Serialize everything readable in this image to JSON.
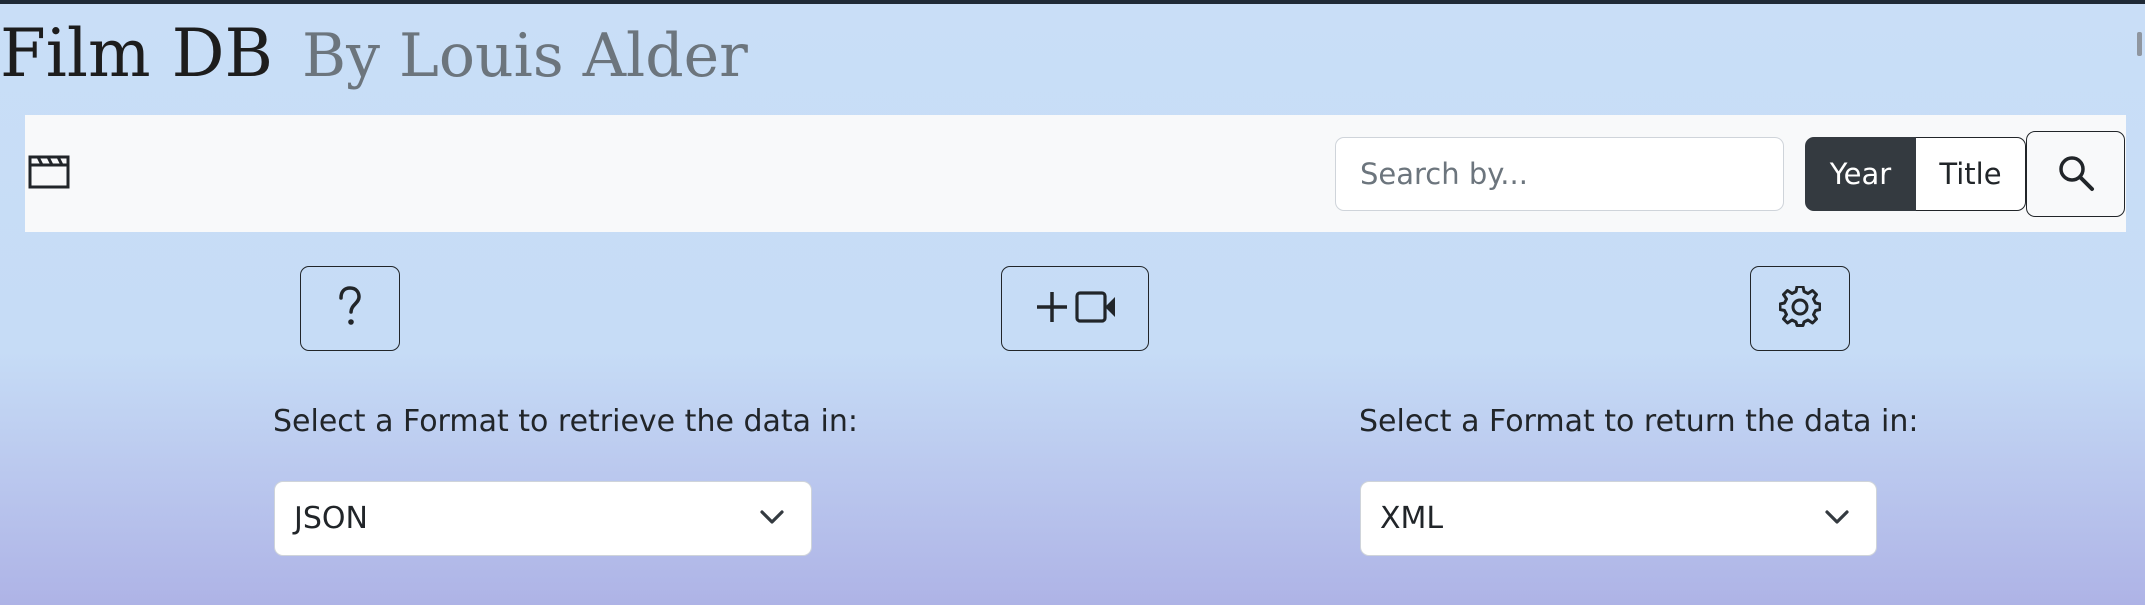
{
  "header": {
    "title": "Film DB",
    "subtitle": "By Louis Alder"
  },
  "navbar": {
    "brand_icon": "film-clapper-icon",
    "search": {
      "placeholder": "Search by...",
      "value": ""
    },
    "toggle": {
      "options": [
        "Year",
        "Title"
      ],
      "selected": "Year"
    },
    "search_button_icon": "search-icon"
  },
  "actions": [
    {
      "name": "help",
      "icon": "question-mark-icon"
    },
    {
      "name": "add-film",
      "icon": "plus-video-icon"
    },
    {
      "name": "settings",
      "icon": "gear-icon"
    }
  ],
  "formats": {
    "retrieve": {
      "label": "Select a Format to retrieve the data in:",
      "selected": "JSON"
    },
    "return": {
      "label": "Select a Format to return the data in:",
      "selected": "XML"
    }
  },
  "colors": {
    "active_toggle": "#343a40",
    "navbar_bg": "#f8f9fa",
    "page_gradient_top": "#c9def7",
    "page_gradient_bottom": "#aeb3e6"
  }
}
